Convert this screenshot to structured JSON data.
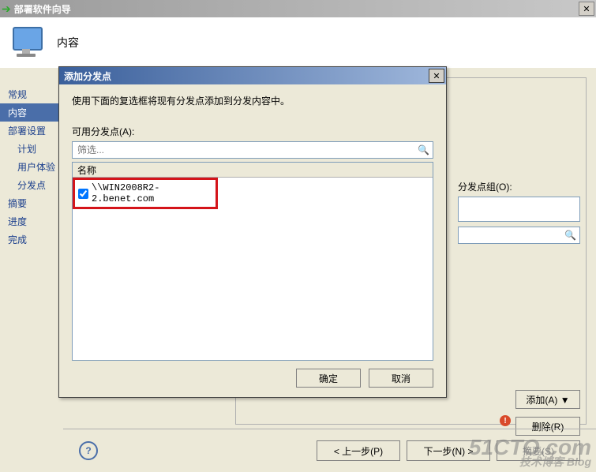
{
  "main_window": {
    "title": "部署软件向导"
  },
  "header": {
    "title": "内容"
  },
  "sidebar": {
    "items": [
      {
        "label": "常规"
      },
      {
        "label": "内容",
        "selected": true
      },
      {
        "label": "部署设置"
      },
      {
        "label": "计划",
        "sub": true
      },
      {
        "label": "用户体验",
        "sub": true
      },
      {
        "label": "分发点",
        "sub": true
      },
      {
        "label": "摘要"
      },
      {
        "label": "进度"
      },
      {
        "label": "完成"
      }
    ]
  },
  "right_panel": {
    "group_label": "分发点组(O):",
    "add_label": "添加(A) ▼",
    "remove_label": "删除(R)"
  },
  "bottom": {
    "prev": "< 上一步(P)",
    "next": "下一步(N) >",
    "summary": "摘要(S)"
  },
  "modal": {
    "title": "添加分发点",
    "desc": "使用下面的复选框将现有分发点添加到分发内容中。",
    "available_label": "可用分发点(A):",
    "filter_placeholder": "筛选...",
    "column_name": "名称",
    "row_value": "\\\\WIN2008R2-2.benet.com",
    "ok": "确定",
    "cancel": "取消"
  },
  "watermark": {
    "big": "51CTO.com",
    "small": "技术博客  Blog"
  }
}
